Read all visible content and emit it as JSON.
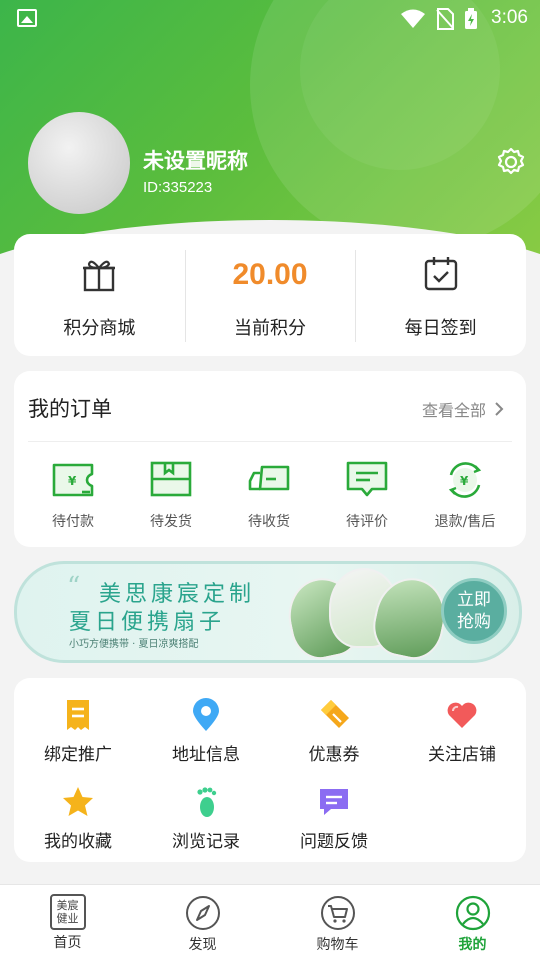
{
  "statusbar": {
    "time": "3:06"
  },
  "profile": {
    "nickname": "未设置昵称",
    "user_id": "ID:335223"
  },
  "points_card": {
    "mall_label": "积分商城",
    "current_points_value": "20.00",
    "current_points_label": "当前积分",
    "checkin_label": "每日签到"
  },
  "orders": {
    "title": "我的订单",
    "view_all": "查看全部",
    "items": [
      {
        "label": "待付款",
        "icon": "wallet-yen-icon"
      },
      {
        "label": "待发货",
        "icon": "package-icon"
      },
      {
        "label": "待收货",
        "icon": "truck-icon"
      },
      {
        "label": "待评价",
        "icon": "comment-icon"
      },
      {
        "label": "退款/售后",
        "icon": "refund-yen-icon"
      }
    ]
  },
  "banner": {
    "line1": "美思康宸定制",
    "line2": "夏日便携扇子",
    "line3": "小巧方便携带 · 夏日凉爽搭配",
    "button_line1": "立即",
    "button_line2": "抢购"
  },
  "tools": [
    {
      "label": "绑定推广",
      "icon": "receipt-icon",
      "color": "#f5b31b"
    },
    {
      "label": "地址信息",
      "icon": "location-pin-icon",
      "color": "#3fa9f5"
    },
    {
      "label": "优惠券",
      "icon": "coupon-icon",
      "color": "#f5a71b"
    },
    {
      "label": "关注店铺",
      "icon": "heart-icon",
      "color": "#f25a5a"
    },
    {
      "label": "我的收藏",
      "icon": "star-icon",
      "color": "#f5b31b"
    },
    {
      "label": "浏览记录",
      "icon": "footprint-icon",
      "color": "#3ecf8e"
    },
    {
      "label": "问题反馈",
      "icon": "feedback-icon",
      "color": "#8b6cf2"
    }
  ],
  "tabbar": {
    "logo_text_top": "美宸",
    "logo_text_bottom": "健业",
    "items": [
      {
        "label": "首页"
      },
      {
        "label": "发现"
      },
      {
        "label": "购物车"
      },
      {
        "label": "我的"
      }
    ]
  },
  "colors": {
    "brand_green": "#3cb54a",
    "accent_orange": "#f08b2b",
    "active_tab": "#1fa33a"
  }
}
